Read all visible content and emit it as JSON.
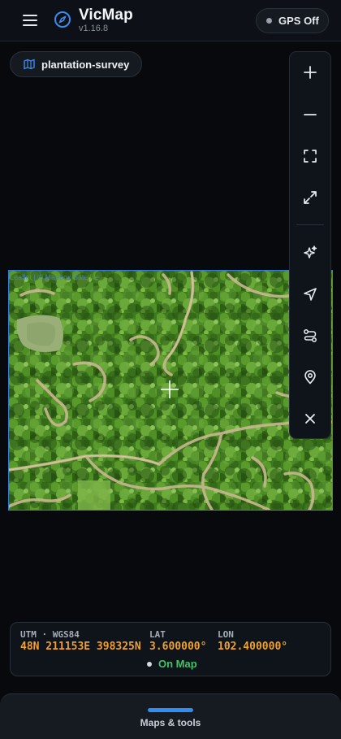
{
  "header": {
    "menu_icon": "hamburger-menu-icon",
    "brand_icon": "compass-icon",
    "title": "VicMap",
    "version": "v1.16.8",
    "gps_button": {
      "label": "GPS Off",
      "status_color": "#9aa0a9"
    }
  },
  "layer_chip": {
    "icon": "map-icon",
    "label": "plantation-survey"
  },
  "map": {
    "attribution": "Leaflet | © Mapbox Satellite",
    "crosshair_icon": "crosshair-icon"
  },
  "tools": [
    {
      "name": "zoom-in",
      "icon": "plus-icon"
    },
    {
      "name": "zoom-out",
      "icon": "minus-icon"
    },
    {
      "name": "fit-bounds",
      "icon": "frame-corners-icon"
    },
    {
      "name": "fullscreen",
      "icon": "expand-icon"
    },
    {
      "name": "ai-detect",
      "icon": "sparkles-icon"
    },
    {
      "name": "navigate",
      "icon": "navigation-arrow-icon"
    },
    {
      "name": "route",
      "icon": "route-icon"
    },
    {
      "name": "marker",
      "icon": "map-pin-icon"
    },
    {
      "name": "close",
      "icon": "close-icon"
    }
  ],
  "coordinates": {
    "utm_label": "UTM · WGS84",
    "utm_value": "48N 211153E 398325N",
    "lat_label": "LAT",
    "lat_value": "3.600000°",
    "lon_label": "LON",
    "lon_value": "102.400000°",
    "status": "On Map",
    "status_color": "#45c06a",
    "value_color": "#f0a030"
  },
  "bottom_sheet": {
    "label": "Maps & tools",
    "accent": "#2f8ef5"
  }
}
